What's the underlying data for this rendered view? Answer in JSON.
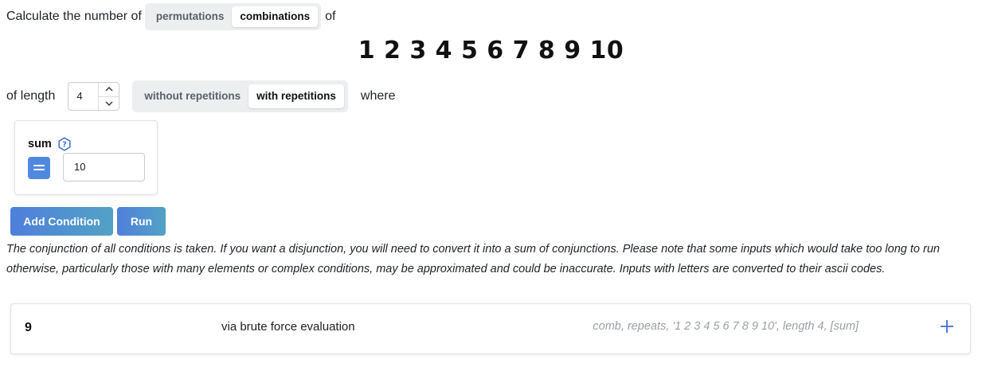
{
  "header": {
    "prefix": "Calculate the number of",
    "modes": [
      "permutations",
      "combinations"
    ],
    "active_mode": "combinations",
    "suffix": "of"
  },
  "elements_display": "1 2 3 4 5 6 7 8 9 10",
  "length_row": {
    "label": "of length",
    "length_value": "4",
    "repetition_options": [
      "without repetitions",
      "with repetitions"
    ],
    "active_repetition": "with repetitions",
    "where_label": "where"
  },
  "condition": {
    "label": "sum",
    "help_icon": "question-hexagon-icon",
    "operator_icon": "equals-icon",
    "value": "10"
  },
  "buttons": {
    "add_condition": "Add Condition",
    "run": "Run"
  },
  "note": "The conjunction of all conditions is taken. If you want a disjunction, you will need to convert it into a sum of conjunctions. Please note that some inputs which would take too long to run otherwise, particularly those with many elements or complex conditions, may be approximated and could be inaccurate. Inputs with letters are converted to their ascii codes.",
  "result": {
    "count": "9",
    "method": "via brute force evaluation",
    "meta": "comb, repeats, '1 2 3 4 5 6 7 8 9 10', length 4, [sum]",
    "expand_icon": "plus-icon"
  },
  "colors": {
    "accent": "#4f89df",
    "button_gradient_start": "#4f7fdc",
    "button_gradient_end": "#52a2c5",
    "segment_bg": "#eceef0",
    "muted_text": "#9aa0a6"
  }
}
